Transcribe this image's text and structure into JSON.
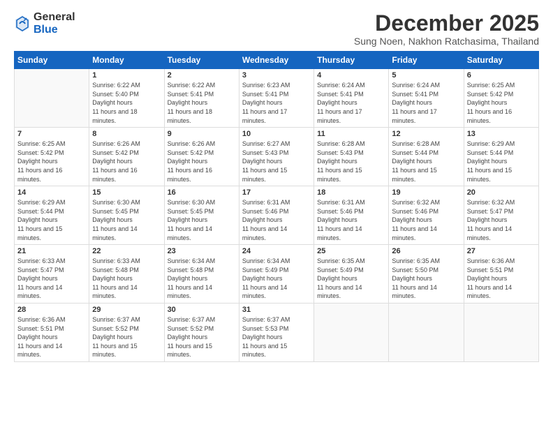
{
  "logo": {
    "general": "General",
    "blue": "Blue"
  },
  "header": {
    "month": "December 2025",
    "location": "Sung Noen, Nakhon Ratchasima, Thailand"
  },
  "weekdays": [
    "Sunday",
    "Monday",
    "Tuesday",
    "Wednesday",
    "Thursday",
    "Friday",
    "Saturday"
  ],
  "days": [
    {
      "date": "",
      "sunrise": "",
      "sunset": "",
      "daylight": ""
    },
    {
      "date": "1",
      "sunrise": "6:22 AM",
      "sunset": "5:40 PM",
      "daylight": "11 hours and 18 minutes."
    },
    {
      "date": "2",
      "sunrise": "6:22 AM",
      "sunset": "5:41 PM",
      "daylight": "11 hours and 18 minutes."
    },
    {
      "date": "3",
      "sunrise": "6:23 AM",
      "sunset": "5:41 PM",
      "daylight": "11 hours and 17 minutes."
    },
    {
      "date": "4",
      "sunrise": "6:24 AM",
      "sunset": "5:41 PM",
      "daylight": "11 hours and 17 minutes."
    },
    {
      "date": "5",
      "sunrise": "6:24 AM",
      "sunset": "5:41 PM",
      "daylight": "11 hours and 17 minutes."
    },
    {
      "date": "6",
      "sunrise": "6:25 AM",
      "sunset": "5:42 PM",
      "daylight": "11 hours and 16 minutes."
    },
    {
      "date": "7",
      "sunrise": "6:25 AM",
      "sunset": "5:42 PM",
      "daylight": "11 hours and 16 minutes."
    },
    {
      "date": "8",
      "sunrise": "6:26 AM",
      "sunset": "5:42 PM",
      "daylight": "11 hours and 16 minutes."
    },
    {
      "date": "9",
      "sunrise": "6:26 AM",
      "sunset": "5:42 PM",
      "daylight": "11 hours and 16 minutes."
    },
    {
      "date": "10",
      "sunrise": "6:27 AM",
      "sunset": "5:43 PM",
      "daylight": "11 hours and 15 minutes."
    },
    {
      "date": "11",
      "sunrise": "6:28 AM",
      "sunset": "5:43 PM",
      "daylight": "11 hours and 15 minutes."
    },
    {
      "date": "12",
      "sunrise": "6:28 AM",
      "sunset": "5:44 PM",
      "daylight": "11 hours and 15 minutes."
    },
    {
      "date": "13",
      "sunrise": "6:29 AM",
      "sunset": "5:44 PM",
      "daylight": "11 hours and 15 minutes."
    },
    {
      "date": "14",
      "sunrise": "6:29 AM",
      "sunset": "5:44 PM",
      "daylight": "11 hours and 15 minutes."
    },
    {
      "date": "15",
      "sunrise": "6:30 AM",
      "sunset": "5:45 PM",
      "daylight": "11 hours and 14 minutes."
    },
    {
      "date": "16",
      "sunrise": "6:30 AM",
      "sunset": "5:45 PM",
      "daylight": "11 hours and 14 minutes."
    },
    {
      "date": "17",
      "sunrise": "6:31 AM",
      "sunset": "5:46 PM",
      "daylight": "11 hours and 14 minutes."
    },
    {
      "date": "18",
      "sunrise": "6:31 AM",
      "sunset": "5:46 PM",
      "daylight": "11 hours and 14 minutes."
    },
    {
      "date": "19",
      "sunrise": "6:32 AM",
      "sunset": "5:46 PM",
      "daylight": "11 hours and 14 minutes."
    },
    {
      "date": "20",
      "sunrise": "6:32 AM",
      "sunset": "5:47 PM",
      "daylight": "11 hours and 14 minutes."
    },
    {
      "date": "21",
      "sunrise": "6:33 AM",
      "sunset": "5:47 PM",
      "daylight": "11 hours and 14 minutes."
    },
    {
      "date": "22",
      "sunrise": "6:33 AM",
      "sunset": "5:48 PM",
      "daylight": "11 hours and 14 minutes."
    },
    {
      "date": "23",
      "sunrise": "6:34 AM",
      "sunset": "5:48 PM",
      "daylight": "11 hours and 14 minutes."
    },
    {
      "date": "24",
      "sunrise": "6:34 AM",
      "sunset": "5:49 PM",
      "daylight": "11 hours and 14 minutes."
    },
    {
      "date": "25",
      "sunrise": "6:35 AM",
      "sunset": "5:49 PM",
      "daylight": "11 hours and 14 minutes."
    },
    {
      "date": "26",
      "sunrise": "6:35 AM",
      "sunset": "5:50 PM",
      "daylight": "11 hours and 14 minutes."
    },
    {
      "date": "27",
      "sunrise": "6:36 AM",
      "sunset": "5:51 PM",
      "daylight": "11 hours and 14 minutes."
    },
    {
      "date": "28",
      "sunrise": "6:36 AM",
      "sunset": "5:51 PM",
      "daylight": "11 hours and 14 minutes."
    },
    {
      "date": "29",
      "sunrise": "6:37 AM",
      "sunset": "5:52 PM",
      "daylight": "11 hours and 15 minutes."
    },
    {
      "date": "30",
      "sunrise": "6:37 AM",
      "sunset": "5:52 PM",
      "daylight": "11 hours and 15 minutes."
    },
    {
      "date": "31",
      "sunrise": "6:37 AM",
      "sunset": "5:53 PM",
      "daylight": "11 hours and 15 minutes."
    }
  ],
  "labels": {
    "sunrise": "Sunrise:",
    "sunset": "Sunset:",
    "daylight": "Daylight hours"
  }
}
